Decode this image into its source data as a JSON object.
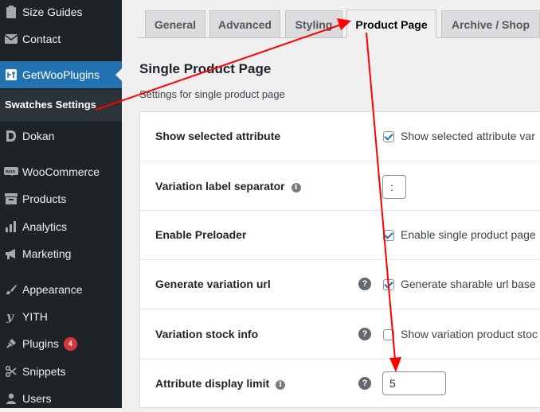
{
  "sidebar": {
    "items": [
      {
        "label": "Size Guides",
        "icon": "clipboard-icon"
      },
      {
        "label": "Contact",
        "icon": "envelope-icon"
      },
      {
        "label": "GetWooPlugins",
        "icon": "getwooplugins-icon"
      },
      {
        "label": "Dokan",
        "icon": "dokan-icon"
      },
      {
        "label": "WooCommerce",
        "icon": "woocommerce-icon"
      },
      {
        "label": "Products",
        "icon": "archive-icon"
      },
      {
        "label": "Analytics",
        "icon": "bar-chart-icon"
      },
      {
        "label": "Marketing",
        "icon": "megaphone-icon"
      },
      {
        "label": "Appearance",
        "icon": "paintbrush-icon"
      },
      {
        "label": "YITH",
        "icon": "yith-icon"
      },
      {
        "label": "Plugins",
        "icon": "plug-icon",
        "badge": "4"
      },
      {
        "label": "Snippets",
        "icon": "scissors-icon"
      },
      {
        "label": "Users",
        "icon": "user-icon"
      }
    ],
    "submenu_label": "Swatches Settings"
  },
  "tabs": [
    "General",
    "Advanced",
    "Styling",
    "Product Page",
    "Archive / Shop"
  ],
  "active_tab": "Product Page",
  "section": {
    "title": "Single Product Page",
    "description": "Settings for single product page"
  },
  "settings": {
    "show_selected_attribute": {
      "label": "Show selected attribute",
      "checkbox_label": "Show selected attribute var",
      "checked": true
    },
    "variation_label_separator": {
      "label": "Variation label separator",
      "value": ":"
    },
    "enable_preloader": {
      "label": "Enable Preloader",
      "checkbox_label": "Enable single product page",
      "checked": true
    },
    "generate_variation_url": {
      "label": "Generate variation url",
      "checkbox_label": "Generate sharable url base",
      "checked": true
    },
    "variation_stock_info": {
      "label": "Variation stock info",
      "checkbox_label": "Show variation product stoc",
      "checked": false
    },
    "attribute_display_limit": {
      "label": "Attribute display limit",
      "value": "5"
    }
  },
  "colors": {
    "sidebar_bg": "#1d2327",
    "active_menu": "#2271b1",
    "badge": "#d63638",
    "annotation_arrow": "#ff0000"
  }
}
